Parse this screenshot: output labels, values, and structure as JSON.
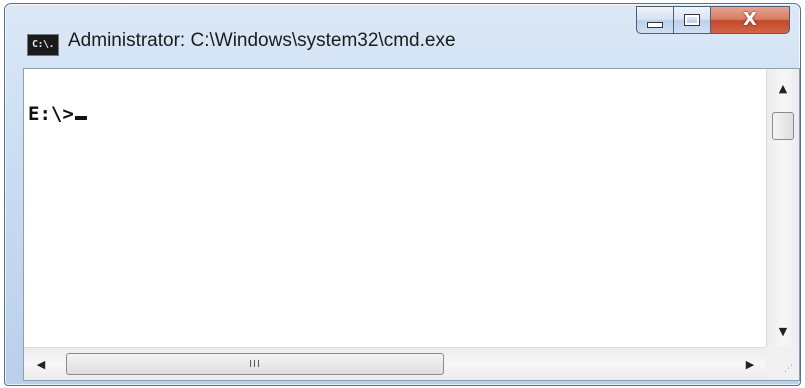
{
  "window": {
    "title": "Administrator: C:\\Windows\\system32\\cmd.exe",
    "icon_label": "C:\\.",
    "icon": "cmd-app-icon",
    "caption_buttons": {
      "minimize_icon": "minimize-icon",
      "maximize_icon": "maximize-icon",
      "close_icon": "close-icon",
      "close_glyph": "X"
    },
    "accent_close": "#c2492b"
  },
  "console": {
    "prompt": "E:\\>",
    "text_color": "#111111",
    "background": "#ffffff"
  },
  "scrollbars": {
    "up_glyph": "▲",
    "down_glyph": "▼",
    "left_glyph": "◀",
    "right_glyph": "▶",
    "h_thumb_grip": "III",
    "size_grip": "⋰"
  }
}
